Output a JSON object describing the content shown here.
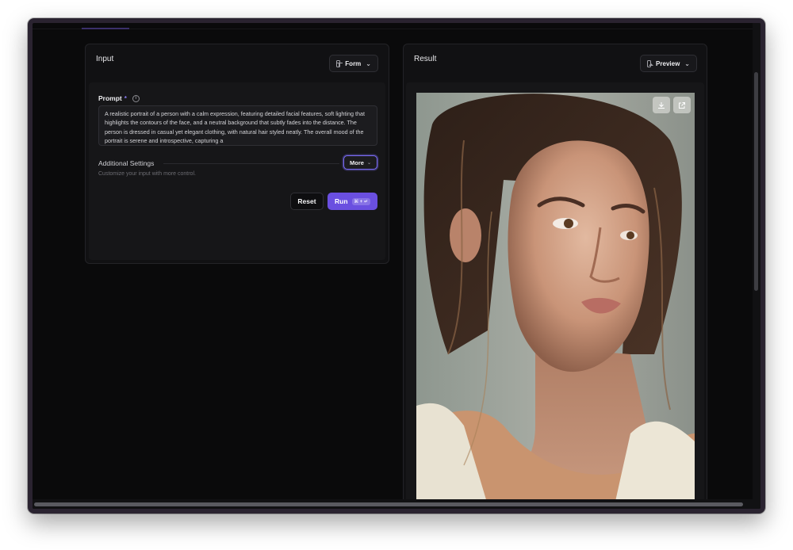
{
  "input_panel": {
    "title": "Input",
    "view_button_label": "Form",
    "view_button_icon": "form-layout-icon",
    "prompt": {
      "label": "Prompt",
      "required_marker": "*",
      "info_icon": "info-icon",
      "value": "A realistic portrait of a person with a calm expression, featuring detailed facial features, soft lighting that highlights the contours of the face, and a neutral background that subtly fades into the distance. The person is dressed in casual yet elegant clothing, with natural hair styled neatly. The overall mood of the portrait is serene and introspective, capturing a"
    },
    "additional_settings": {
      "title": "Additional Settings",
      "subtitle": "Customize your input with more control.",
      "more_label": "More"
    },
    "actions": {
      "reset_label": "Reset",
      "run_label": "Run",
      "run_shortcut": "⌘ + ↵"
    }
  },
  "result_panel": {
    "title": "Result",
    "view_button_label": "Preview",
    "view_button_icon": "image-icon",
    "image_alt": "Portrait of a woman with a calm expression",
    "image_actions": [
      "download-icon",
      "external-link-icon"
    ]
  },
  "colors": {
    "background": "#0a0a0b",
    "panel": "#111113",
    "accent": "#6a4fe0",
    "focus_ring": "#7b6cf6"
  }
}
